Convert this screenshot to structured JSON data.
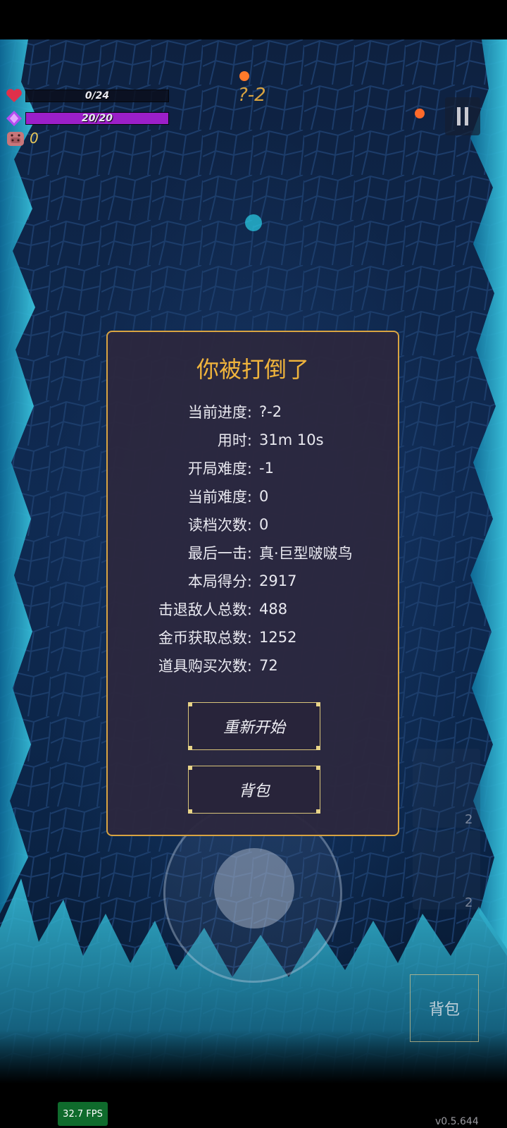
{
  "hud": {
    "hp": {
      "text": "0/24",
      "fraction": 0.0,
      "color": "#c0283c"
    },
    "mana": {
      "text": "20/20",
      "fraction": 1.0,
      "color": "#9b1fc9"
    },
    "coins": "0",
    "level": "?-2"
  },
  "dialog": {
    "title": "你被打倒了",
    "stats": [
      {
        "label": "当前进度:",
        "value": "?-2"
      },
      {
        "label": "用时:",
        "value": "31m 10s"
      },
      {
        "label": "开局难度:",
        "value": "-1"
      },
      {
        "label": "当前难度:",
        "value": "0"
      },
      {
        "label": "读档次数:",
        "value": "0"
      },
      {
        "label": "最后一击:",
        "value": "真·巨型啵啵鸟"
      },
      {
        "label": "本局得分:",
        "value": "2917"
      },
      {
        "label": "击退敌人总数:",
        "value": "488"
      },
      {
        "label": "金币获取总数:",
        "value": "1252"
      },
      {
        "label": "道具购买次数:",
        "value": "72"
      }
    ],
    "restart_label": "重新开始",
    "backpack_label": "背包"
  },
  "controls": {
    "skill1_count": "2",
    "skill2_count": "2",
    "bag_label": "背包"
  },
  "footer": {
    "fps": "32.7 FPS",
    "version": "v0.5.644"
  },
  "colors": {
    "accent": "#d9a441",
    "title": "#f0b43c",
    "dialog_bg": "#2c283e"
  }
}
